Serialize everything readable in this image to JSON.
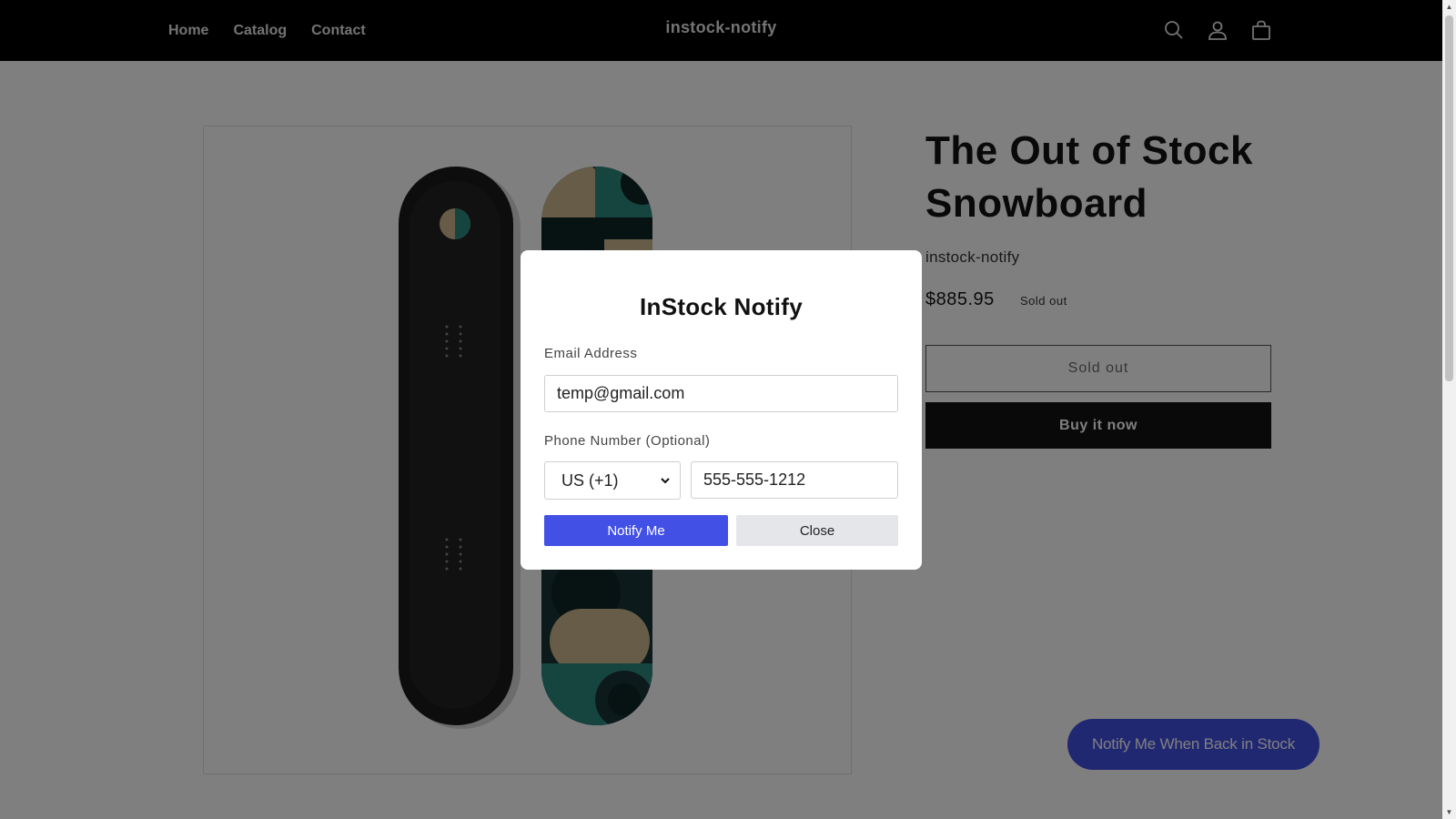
{
  "header": {
    "nav": [
      "Home",
      "Catalog",
      "Contact"
    ],
    "logo": "instock-notify",
    "icons": [
      "search-icon",
      "account-icon",
      "cart-icon"
    ],
    "background": "#000000"
  },
  "product": {
    "title": "The Out of Stock Snowboard",
    "vendor": "instock-notify",
    "price": "$885.95",
    "badge": "Sold out",
    "sold_out_button": "Sold out",
    "buy_now_button": "Buy it now"
  },
  "modal": {
    "title": "InStock Notify",
    "email_label": "Email Address",
    "email_value": "temp@gmail.com",
    "phone_label": "Phone Number (Optional)",
    "country_selected": "US (+1)",
    "phone_value": "555-555-1212",
    "notify_button": "Notify Me",
    "close_button": "Close"
  },
  "floating_button": {
    "label": "Notify Me When Back in Stock"
  },
  "colors": {
    "accent": "#4250e5",
    "overlay": "rgba(0,0,0,0.5)",
    "buy_now": "#121212"
  }
}
